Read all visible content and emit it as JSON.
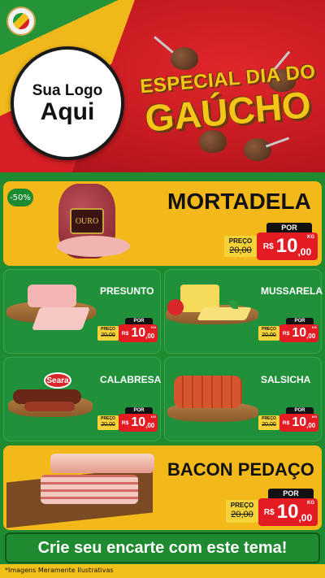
{
  "header": {
    "logo_line1": "Sua Logo",
    "logo_line2": "Aqui",
    "title_line1": "ESPECIAL DIA DO",
    "title_line2": "GAÚCHO"
  },
  "featured": [
    {
      "name": "MORTADELA",
      "badge": "-50%",
      "brand": "OURO",
      "old_label": "PREÇO",
      "old_price": "20,00",
      "por_label": "POR",
      "currency": "R$",
      "price_int": "10",
      "price_dec": ",00",
      "unit": "KG"
    },
    {
      "name": "BACON PEDAÇO",
      "old_label": "PREÇO",
      "old_price": "20,00",
      "por_label": "POR",
      "currency": "R$",
      "price_int": "10",
      "price_dec": ",00",
      "unit": "KG"
    }
  ],
  "products": [
    {
      "name": "PRESUNTO",
      "old_label": "PREÇO",
      "old_price": "20,00",
      "por_label": "POR",
      "currency": "R$",
      "price_int": "10",
      "price_dec": ",00",
      "unit": "KG"
    },
    {
      "name": "MUSSARELA",
      "old_label": "PREÇO",
      "old_price": "20,00",
      "por_label": "POR",
      "currency": "R$",
      "price_int": "10",
      "price_dec": ",00",
      "unit": "KG"
    },
    {
      "name": "CALABRESA",
      "brand": "Seara",
      "old_label": "PREÇO",
      "old_price": "20,00",
      "por_label": "POR",
      "currency": "R$",
      "price_int": "10",
      "price_dec": ",00",
      "unit": "KG"
    },
    {
      "name": "SALSICHA",
      "old_label": "PREÇO",
      "old_price": "20,00",
      "por_label": "POR",
      "currency": "R$",
      "price_int": "10",
      "price_dec": ",00",
      "unit": "KG"
    }
  ],
  "cta": "Crie seu encarte com este tema!",
  "disclaimer": "*Imagens Meramente Ilustrativas",
  "colors": {
    "red": "#e31b23",
    "green": "#21903a",
    "yellow": "#f3b81a",
    "gold_text": "#f5c518"
  },
  "icons": [
    "gaucho-emblem-icon",
    "chimarrao-gourd-icon"
  ]
}
